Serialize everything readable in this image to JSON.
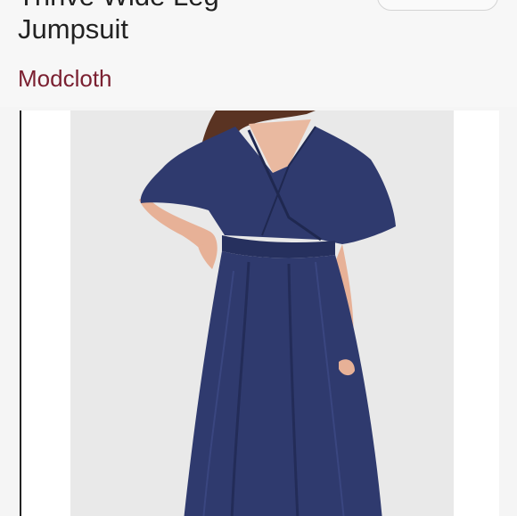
{
  "listing": {
    "title_line1": "Thrive Wide Leg",
    "title_line2": "Jumpsuit",
    "brand": "Modcloth"
  },
  "colors": {
    "brand": "#7a1f30",
    "jumpsuit": "#2f3a6e",
    "photo_background": "#e9e9e9"
  }
}
